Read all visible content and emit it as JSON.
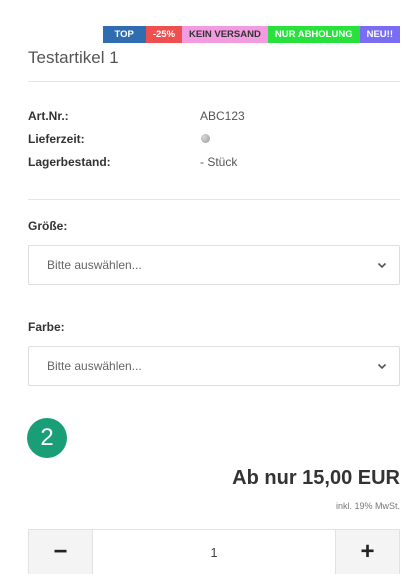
{
  "badges": [
    {
      "label": "TOP"
    },
    {
      "label": "-25%"
    },
    {
      "label": "KEIN VERSAND"
    },
    {
      "label": "NUR ABHOLUNG"
    },
    {
      "label": "NEU!!"
    }
  ],
  "product": {
    "title": "Testartikel 1"
  },
  "info": [
    {
      "key": "Art.Nr.:",
      "value": "ABC123"
    },
    {
      "key": "Lieferzeit:",
      "value": ""
    },
    {
      "key": "Lagerbestand:",
      "value": "- Stück"
    }
  ],
  "options": {
    "size": {
      "label": "Größe:",
      "value": "Bitte auswählen..."
    },
    "color": {
      "label": "Farbe:",
      "value": "Bitte auswählen..."
    }
  },
  "step_number": "2",
  "price": {
    "text": "Ab nur 15,00 EUR",
    "tax_note": "inkl. 19% MwSt."
  },
  "quantity": {
    "minus": "−",
    "value": "1",
    "plus": "+"
  },
  "colors": {
    "step_circle": "#1a9e78",
    "availability_dot": "#b0b0b0"
  }
}
